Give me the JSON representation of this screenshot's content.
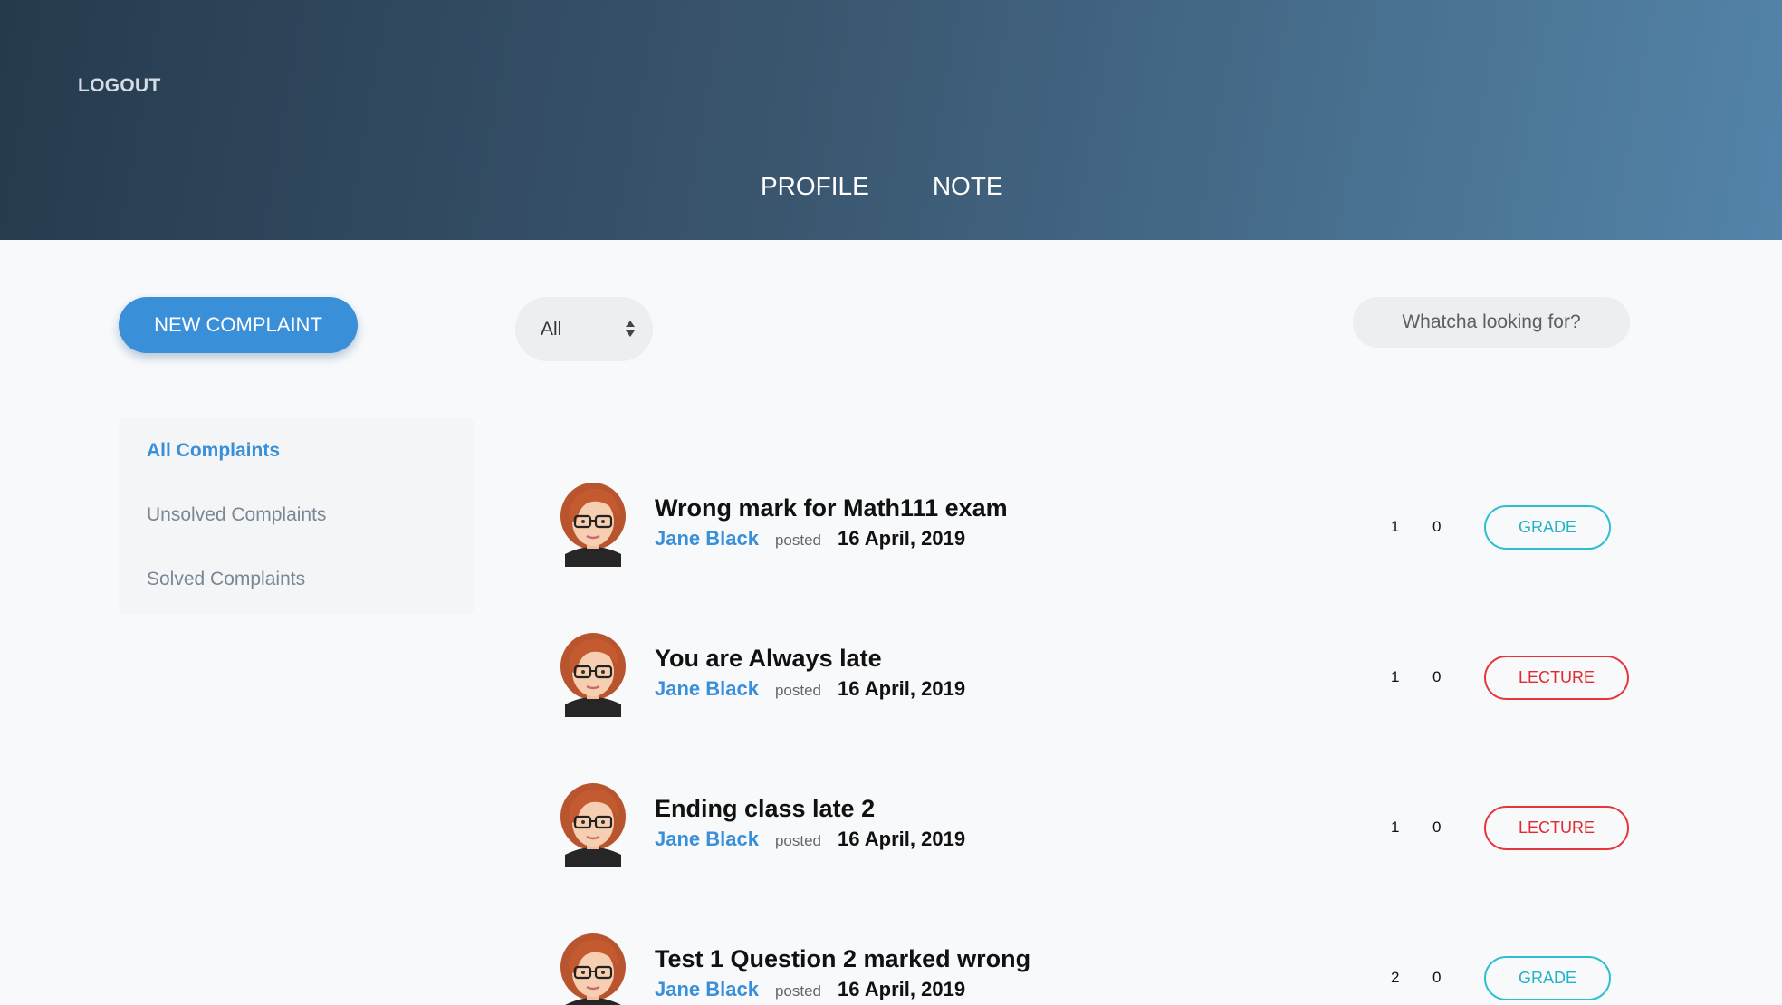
{
  "header": {
    "logout_label": "LOGOUT",
    "nav": [
      {
        "label": "PROFILE"
      },
      {
        "label": "NOTE"
      }
    ]
  },
  "toolbar": {
    "new_complaint_label": "NEW COMPLAINT",
    "filter_value": "All",
    "search_placeholder": "Whatcha looking for?"
  },
  "sidebar": {
    "items": [
      {
        "label": "All Complaints",
        "active": true
      },
      {
        "label": "Unsolved Complaints",
        "active": false
      },
      {
        "label": "Solved Complaints",
        "active": false
      }
    ]
  },
  "complaints": [
    {
      "title": "Wrong mark for Math111 exam",
      "author": "Jane Black",
      "posted_label": "posted",
      "date": "16 April, 2019",
      "count1": "1",
      "count2": "0",
      "tag": "GRADE"
    },
    {
      "title": "You are Always late",
      "author": "Jane Black",
      "posted_label": "posted",
      "date": "16 April, 2019",
      "count1": "1",
      "count2": "0",
      "tag": "LECTURE"
    },
    {
      "title": "Ending class late 2",
      "author": "Jane Black",
      "posted_label": "posted",
      "date": "16 April, 2019",
      "count1": "1",
      "count2": "0",
      "tag": "LECTURE"
    },
    {
      "title": "Test 1 Question 2 marked wrong",
      "author": "Jane Black",
      "posted_label": "posted",
      "date": "16 April, 2019",
      "count1": "2",
      "count2": "0",
      "tag": "GRADE"
    }
  ],
  "colors": {
    "accent": "#3a8fd9",
    "grade_tag": "#21b3c4",
    "lecture_tag": "#e02a30",
    "header_start": "#263a4d",
    "header_end": "#5384a9"
  }
}
